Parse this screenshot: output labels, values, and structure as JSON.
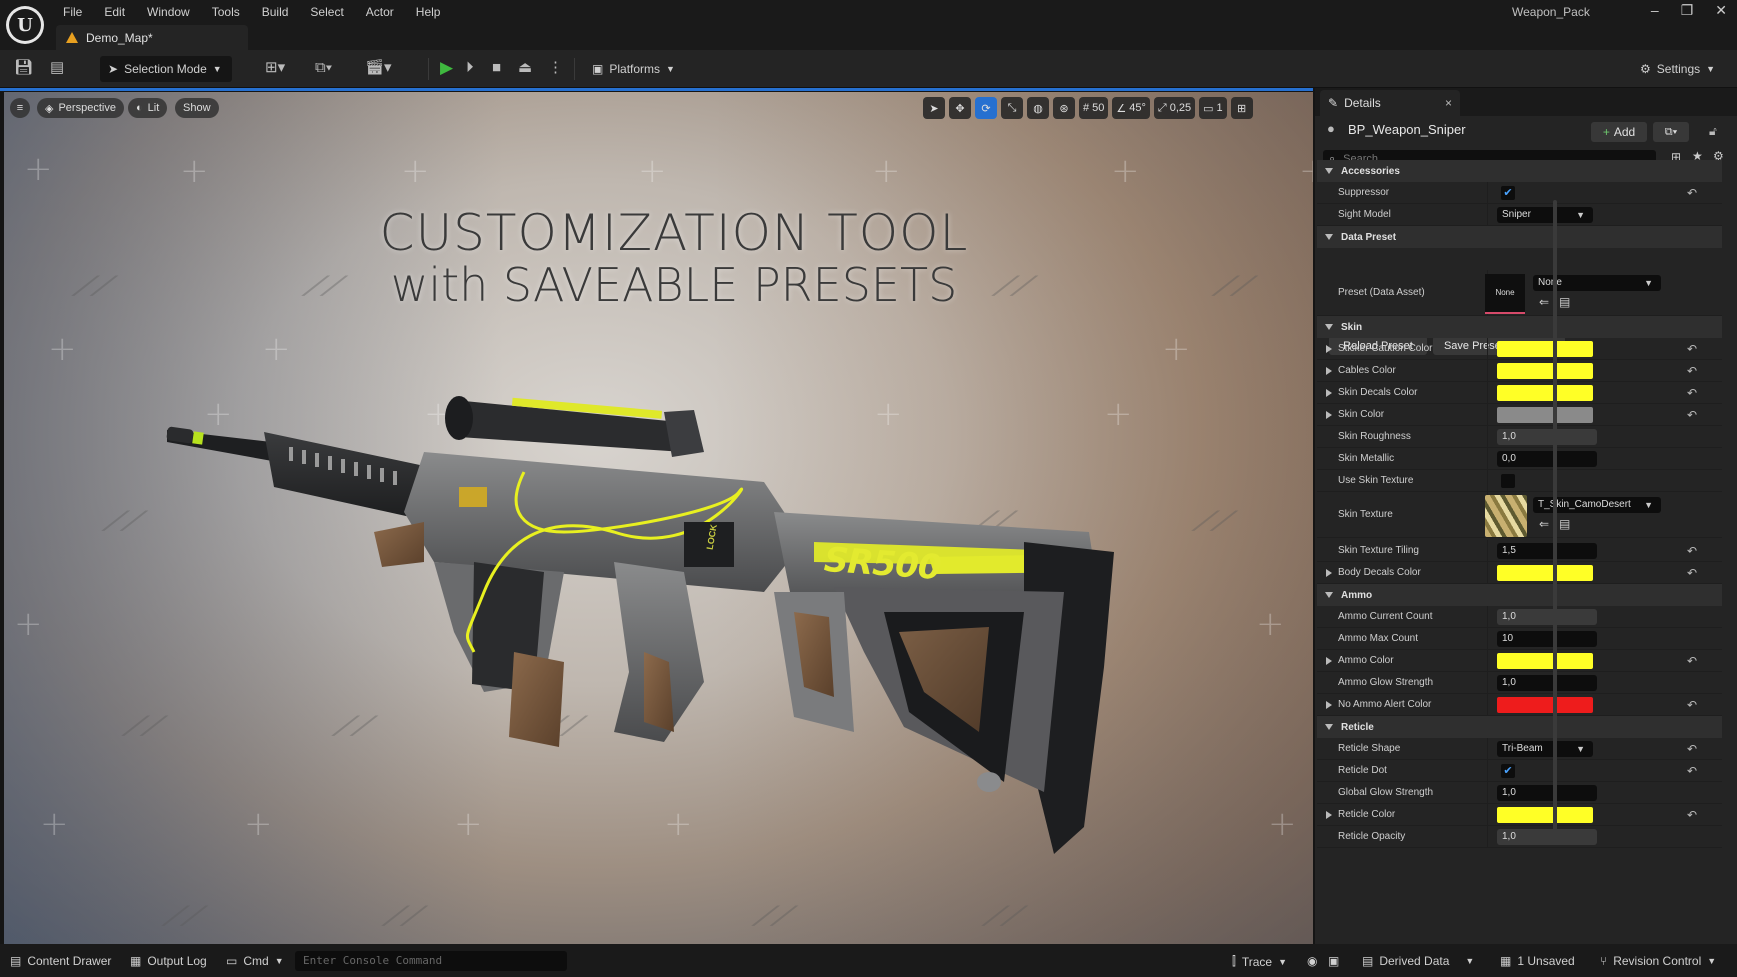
{
  "app": {
    "project_name": "Weapon_Pack",
    "map_tab": "Demo_Map*"
  },
  "menu": [
    "File",
    "Edit",
    "Window",
    "Tools",
    "Build",
    "Select",
    "Actor",
    "Help"
  ],
  "window_controls": {
    "minimize": "–",
    "restore": "❐",
    "close": "✕"
  },
  "toolbar": {
    "selection_mode": "Selection Mode",
    "platforms": "Platforms",
    "settings": "Settings"
  },
  "viewport": {
    "perspective": "Perspective",
    "lit": "Lit",
    "show": "Show",
    "grid_size": "50",
    "rotation_snap": "45°",
    "scale_snap": "0,25",
    "camera_speed": "1",
    "headline_line1": "CUSTOMIZATION TOOL",
    "headline_line2": "with SAVEABLE PRESETS",
    "gun_logo": "SR500",
    "gun_label": "LOCK"
  },
  "details": {
    "tab_label": "Details",
    "object_name": "BP_Weapon_Sniper",
    "add_label": "Add",
    "search_placeholder": "Search",
    "accessories": {
      "title": "Accessories",
      "suppressor": {
        "label": "Suppressor",
        "checked": true
      },
      "sight_model": {
        "label": "Sight Model",
        "value": "Sniper"
      }
    },
    "data_preset": {
      "title": "Data Preset",
      "reload": "Reload Preset",
      "save": "Save Preset (override)",
      "preset_label": "Preset (Data Asset)",
      "preset_thumb": "None",
      "preset_value": "None"
    },
    "skin": {
      "title": "Skin",
      "sticker_caution_color": {
        "label": "Sticker Caution Color",
        "color": "#ffff26"
      },
      "cables_color": {
        "label": "Cables Color",
        "color": "#ffff26"
      },
      "skin_decals_color": {
        "label": "Skin Decals Color",
        "color": "#ffff26"
      },
      "skin_color": {
        "label": "Skin Color",
        "color": "#8a8a8a"
      },
      "skin_roughness": {
        "label": "Skin Roughness",
        "value": "1,0"
      },
      "skin_metallic": {
        "label": "Skin Metallic",
        "value": "0,0"
      },
      "use_skin_texture": {
        "label": "Use Skin Texture",
        "checked": false
      },
      "skin_texture": {
        "label": "Skin Texture",
        "value": "T_Skin_CamoDesert"
      },
      "skin_texture_tiling": {
        "label": "Skin Texture Tiling",
        "value": "1,5"
      },
      "body_decals_color": {
        "label": "Body Decals Color",
        "color": "#ffff26"
      }
    },
    "ammo": {
      "title": "Ammo",
      "ammo_current_count": {
        "label": "Ammo Current Count",
        "value": "1,0"
      },
      "ammo_max_count": {
        "label": "Ammo Max Count",
        "value": "10"
      },
      "ammo_color": {
        "label": "Ammo Color",
        "color": "#ffff26"
      },
      "ammo_glow_strength": {
        "label": "Ammo Glow Strength",
        "value": "1,0"
      },
      "no_ammo_alert_color": {
        "label": "No Ammo Alert Color",
        "color": "#ee1c1c"
      }
    },
    "reticle": {
      "title": "Reticle",
      "reticle_shape": {
        "label": "Reticle Shape",
        "value": "Tri-Beam"
      },
      "reticle_dot": {
        "label": "Reticle Dot",
        "checked": true
      },
      "global_glow_strength": {
        "label": "Global Glow Strength",
        "value": "1,0"
      },
      "reticle_color": {
        "label": "Reticle Color",
        "color": "#ffff26"
      },
      "reticle_opacity": {
        "label": "Reticle Opacity",
        "value": "1,0"
      }
    }
  },
  "statusbar": {
    "content_drawer": "Content Drawer",
    "output_log": "Output Log",
    "cmd": "Cmd",
    "console_placeholder": "Enter Console Command",
    "trace": "Trace",
    "derived_data": "Derived Data",
    "unsaved": "1 Unsaved",
    "revision_control": "Revision Control"
  },
  "colors": {
    "accent_blue": "#2670d0",
    "yellow": "#ffff26",
    "alert_red": "#ee1c1c",
    "play_green": "#3fb93f"
  }
}
